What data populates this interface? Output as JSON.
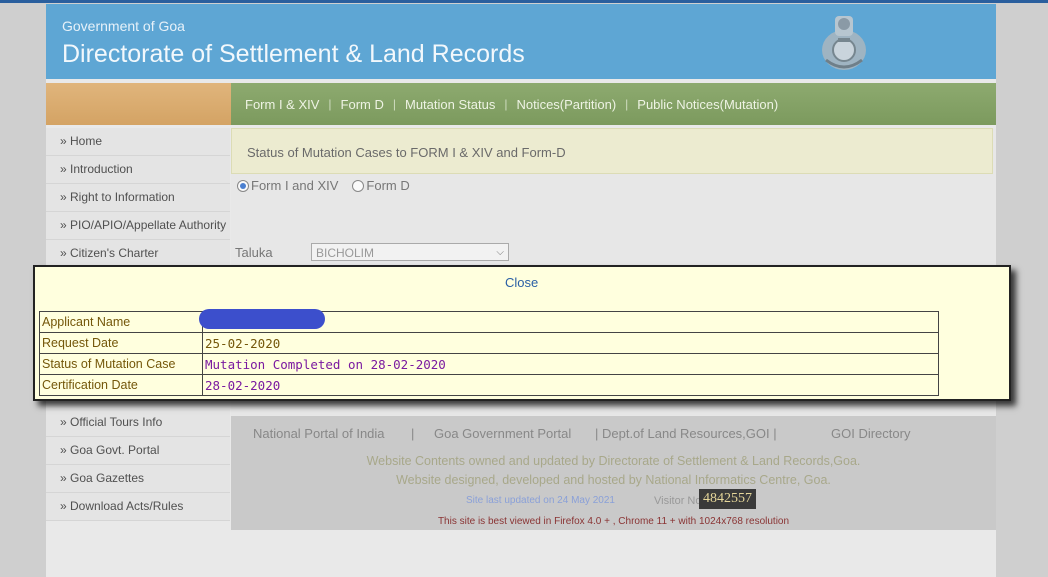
{
  "header": {
    "gov_label": "Government of Goa",
    "title": "Directorate of Settlement & Land Records",
    "emblem_icon": "state-emblem-icon"
  },
  "nav": {
    "items": [
      "Form I & XIV",
      "Form D",
      "Mutation Status",
      "Notices(Partition)",
      "Public Notices(Mutation)"
    ]
  },
  "sidebar": {
    "top_items": [
      "» Home",
      "» Introduction",
      "» Right to Information",
      "» PIO/APIO/Appellate Authority",
      "» Citizen's Charter"
    ],
    "bottom_items": [
      "» Official Tours Info",
      "» Goa Govt. Portal",
      "» Goa Gazettes",
      "» Download Acts/Rules"
    ]
  },
  "main": {
    "status_title": "Status of Mutation Cases to FORM I & XIV and Form-D",
    "radio_options": [
      {
        "label": "Form I and XIV",
        "selected": true
      },
      {
        "label": "Form D",
        "selected": false
      }
    ],
    "taluka_label": "Taluka",
    "taluka_value": "BICHOLIM"
  },
  "modal": {
    "close_label": "Close",
    "rows": [
      {
        "label": "Applicant Name",
        "value": "",
        "redacted": true
      },
      {
        "label": "Request Date",
        "value": "25-02-2020"
      },
      {
        "label": "Status of Mutation Case",
        "value": "Mutation Completed on 28-02-2020"
      },
      {
        "label": "Certification Date",
        "value": "28-02-2020"
      }
    ]
  },
  "footer": {
    "links": [
      "National Portal of India",
      "|",
      "Goa Government Portal",
      "| Dept.of Land Resources,GOI |",
      "GOI Directory"
    ],
    "line1": "Website Contents owned and updated by Directorate of Settlement & Land Records,Goa.",
    "line2": "Website designed, developed and hosted by National Informatics Centre, Goa.",
    "updated": "Site last updated on 24 May 2021",
    "visitor_label": "Visitor No:",
    "visitor_count": "4842557",
    "best_viewed": "This site is best viewed in Firefox 4.0 + , Chrome 11 + with 1024x768 resolution"
  },
  "colors": {
    "header_blue": "#5ea6d4",
    "nav_green": "#7c9a5e",
    "modal_bg": "#ffffde",
    "redaction": "#3c4fcc"
  }
}
